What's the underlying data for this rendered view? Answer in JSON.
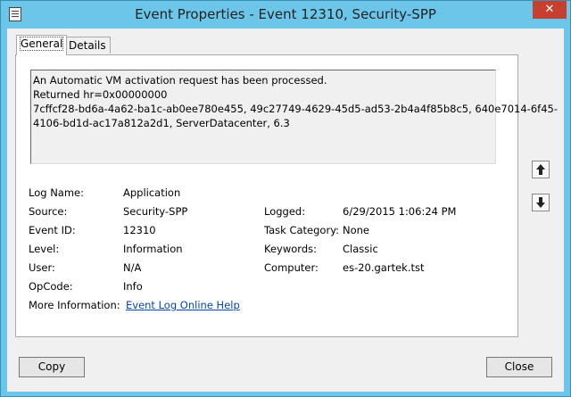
{
  "window": {
    "title": "Event Properties - Event 12310, Security-SPP",
    "close_glyph": "✕"
  },
  "tabs": [
    {
      "label": "General",
      "active": true
    },
    {
      "label": "Details",
      "active": false
    }
  ],
  "description": [
    "An Automatic VM activation request has been processed.",
    "Returned hr=0x00000000",
    "7cffcf28-bd6a-4a62-ba1c-ab0ee780e455, 49c27749-4629-45d5-ad53-2b4a4f85b8c5, 640e7014-6f45-",
    "4106-bd1d-ac17a812a2d1, ServerDatacenter, 6.3"
  ],
  "fields": {
    "log_name": {
      "label": "Log Name:",
      "value": "Application"
    },
    "source": {
      "label": "Source:",
      "value": "Security-SPP"
    },
    "event_id": {
      "label": "Event ID:",
      "value": "12310"
    },
    "level": {
      "label": "Level:",
      "value": "Information"
    },
    "user": {
      "label": "User:",
      "value": "N/A"
    },
    "opcode": {
      "label": "OpCode:",
      "value": "Info"
    },
    "more_info": {
      "label": "More Information:",
      "value": "Event Log Online Help"
    },
    "logged": {
      "label": "Logged:",
      "value": "6/29/2015 1:06:24 PM"
    },
    "task_category": {
      "label": "Task Category:",
      "value": "None"
    },
    "keywords": {
      "label": "Keywords:",
      "value": "Classic"
    },
    "computer": {
      "label": "Computer:",
      "value": "es-20.gartek.tst"
    }
  },
  "buttons": {
    "copy": "Copy",
    "close": "Close"
  },
  "icons": [
    "document-icon",
    "close-icon",
    "arrow-up-icon",
    "arrow-down-icon"
  ]
}
